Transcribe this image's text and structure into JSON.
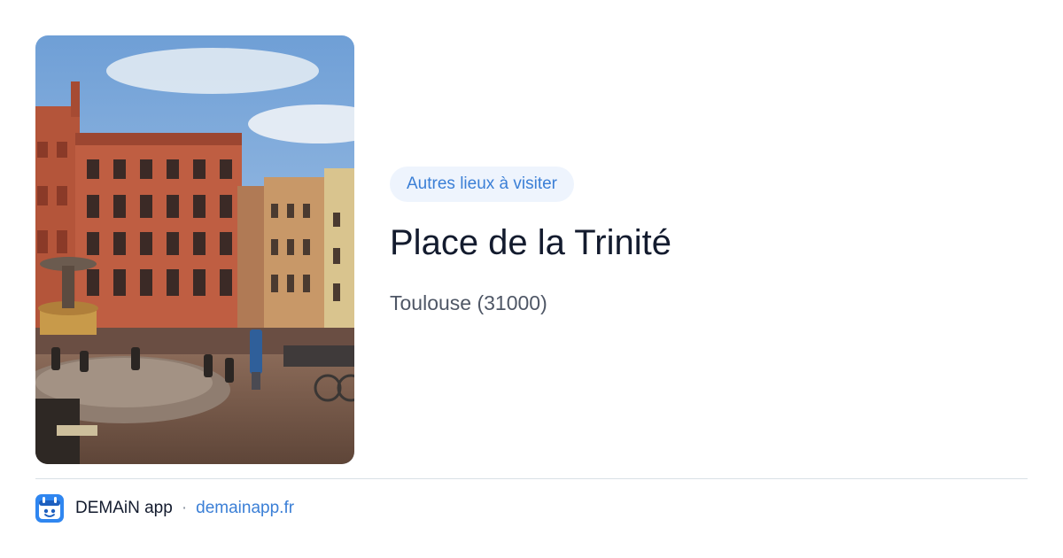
{
  "tag": {
    "label": "Autres lieux à visiter"
  },
  "place": {
    "title": "Place de la Trinité",
    "location": "Toulouse (31000)"
  },
  "footer": {
    "brand": "DEMAiN app",
    "separator": "·",
    "domain": "demainapp.fr"
  },
  "colors": {
    "accent": "#3b7fd6",
    "tag_background": "#eef4fd",
    "title": "#131b2e",
    "muted": "#4f5766",
    "divider": "#d9e0e6"
  },
  "icons": {
    "photo": "place-photo",
    "logo": "demain-app-logo"
  }
}
